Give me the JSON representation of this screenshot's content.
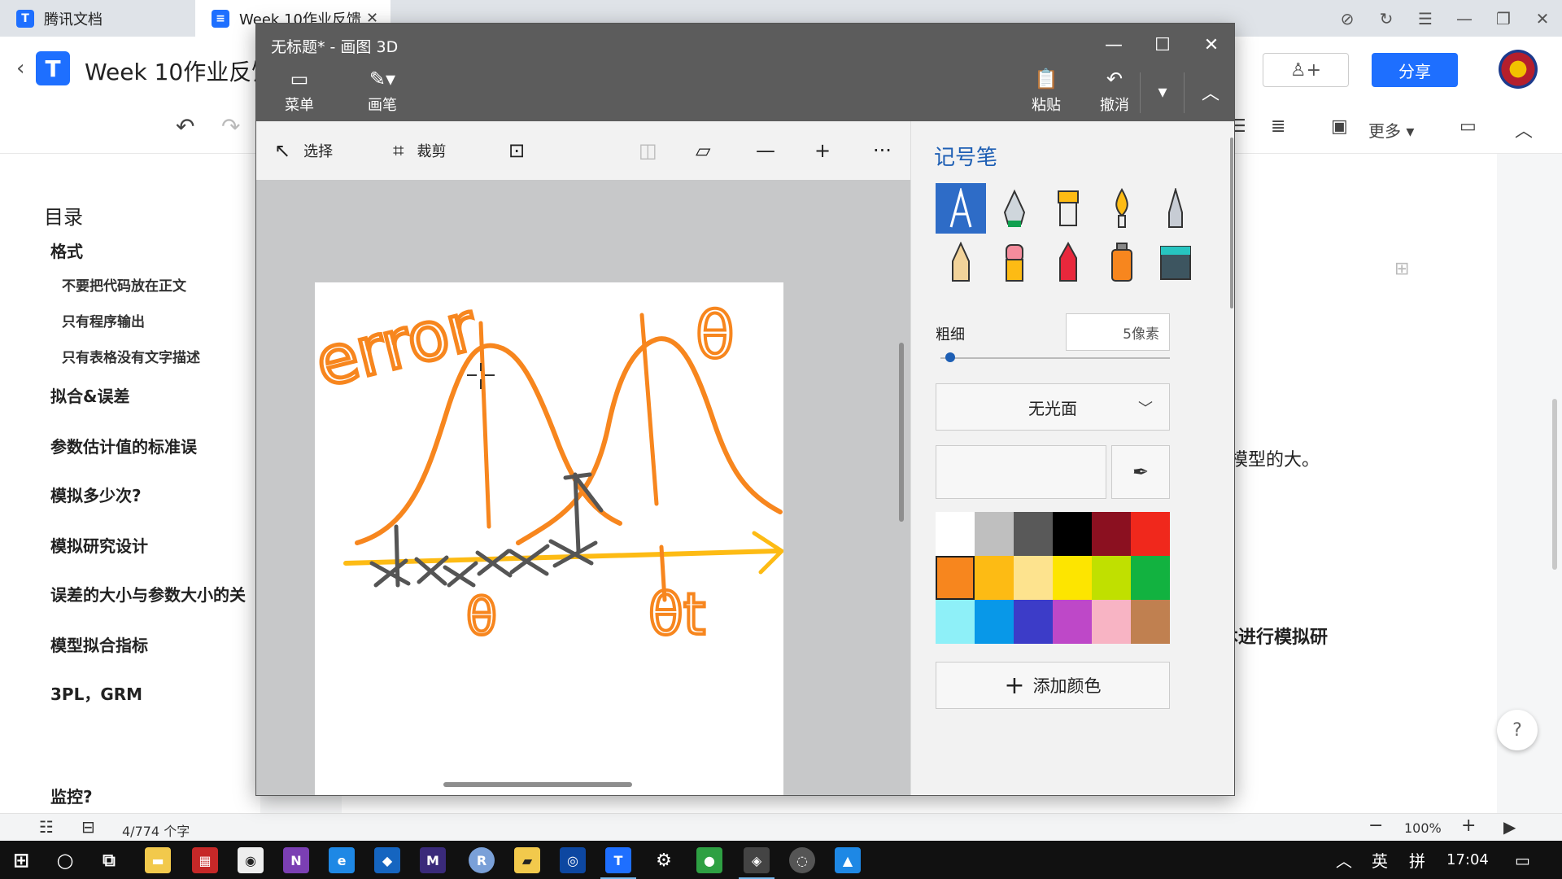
{
  "browser": {
    "tabs": [
      {
        "label": "腾讯文档"
      },
      {
        "label": "Week 10作业反馈"
      }
    ],
    "close_glyph": "✕"
  },
  "doc": {
    "title": "Week 10作业反馈",
    "share_label": "分享",
    "collab_glyph": "♙+",
    "more_label": "更多",
    "toc_title": "目录",
    "toc": [
      {
        "label": "格式",
        "level": 1
      },
      {
        "label": "不要把代码放在正文",
        "level": 2
      },
      {
        "label": "只有程序输出",
        "level": 2
      },
      {
        "label": "只有表格没有文字描述",
        "level": 2
      },
      {
        "label": "拟合&误差",
        "level": 1
      },
      {
        "label": "参数估计值的标准误",
        "level": 1
      },
      {
        "label": "模拟多少次?",
        "level": 1
      },
      {
        "label": "模拟研究设计",
        "level": 1
      },
      {
        "label": "误差的大小与参数大小的关",
        "level": 1
      },
      {
        "label": "模型拟合指标",
        "level": 1
      },
      {
        "label": "3PL，GRM",
        "level": 1
      },
      {
        "label": "监控?",
        "level": 1
      }
    ],
    "body_fragments": [
      "模型的大。",
      "本进行模拟研"
    ],
    "word_count": "4/774 个字",
    "zoom": "100%",
    "help_glyph": "?"
  },
  "paint3d": {
    "title": "无标题* - 画图 3D",
    "ribbon": {
      "menu": "菜单",
      "brushes": "画笔",
      "paste": "粘贴",
      "undo": "撤消"
    },
    "tools": {
      "select": "选择",
      "crop": "裁剪"
    },
    "side": {
      "title": "记号笔",
      "thickness_label": "粗细",
      "thickness_value": "5像素",
      "thickness_fraction": 0.02,
      "finish": "无光面",
      "add_color": "添加颜色",
      "palette": [
        "#ffffff",
        "#bfbfbf",
        "#595959",
        "#000000",
        "#8b1020",
        "#f0281c",
        "#f7861e",
        "#fdbb14",
        "#fde38e",
        "#fde500",
        "#c0e000",
        "#12b240",
        "#8ef0f8",
        "#0898e8",
        "#3c3cc8",
        "#be48c8",
        "#f8b4c4",
        "#c08050"
      ],
      "selected_color": "#f7861e"
    },
    "drawing": {
      "texts": [
        "error",
        "θ",
        "θt"
      ],
      "stroke_colors": {
        "orange": "#f7861e",
        "yellow": "#fdbb14",
        "gray": "#555555"
      }
    }
  },
  "taskbar": {
    "ime": "英",
    "ime2": "拼",
    "time": "17:04"
  }
}
